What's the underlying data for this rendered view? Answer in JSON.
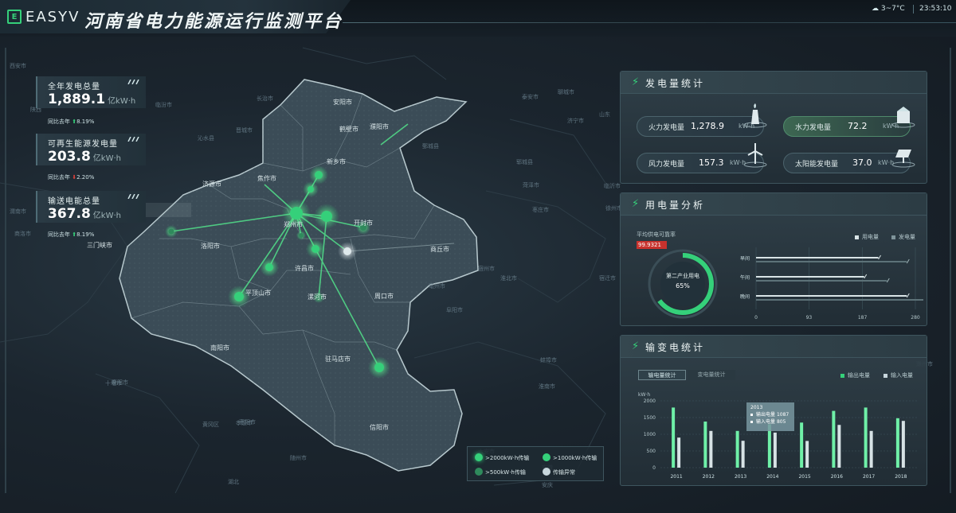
{
  "header": {
    "logo_mark": "E",
    "logo": "EASYV",
    "title": "河南省电力能源运行监测平台",
    "weather_icon": "cloud-icon",
    "temperature": "3~7°C",
    "time": "23:53:10"
  },
  "kpis": [
    {
      "label": "全年发电总量",
      "value": "1,889.1",
      "unit": "亿kW·h",
      "compare_label": "同比去年",
      "trend": "up",
      "change": "8.19%"
    },
    {
      "label": "可再生能源发电量",
      "value": "203.8",
      "unit": "亿kW·h",
      "compare_label": "同比去年",
      "trend": "down",
      "change": "2.20%"
    },
    {
      "label": "输送电能总量",
      "value": "367.8",
      "unit": "亿kW·h",
      "compare_label": "同比去年",
      "trend": "up",
      "change": "8.19%"
    }
  ],
  "map": {
    "cities": [
      "安阳市",
      "鹤壁市",
      "濮阳市",
      "新乡市",
      "焦作市",
      "济源市",
      "郑州市",
      "开封市",
      "洛阳市",
      "三门峡市",
      "许昌市",
      "平顶山市",
      "漯河市",
      "周口市",
      "商丘市",
      "南阳市",
      "驻马店市",
      "信阳市"
    ],
    "neighbors": [
      "陕西",
      "长治市",
      "运城市",
      "晋城市",
      "临汾市",
      "沁水县",
      "聊城市",
      "泰安市",
      "济宁市",
      "山东",
      "鄄城县",
      "郓城县",
      "菏泽市",
      "枣庄市",
      "临沂市",
      "徐州市",
      "宿州市",
      "淮北市",
      "亳州市",
      "阜阳市",
      "蚌埠市",
      "淮南市",
      "宿迁市",
      "六安市",
      "安庆",
      "随州市",
      "襄阳市",
      "孝感市",
      "十堰市",
      "商洛市",
      "渭南市",
      "西安市",
      "湖北",
      "安徽",
      "滁州市",
      "枣阳市",
      "黄冈区"
    ]
  },
  "map_legend": [
    {
      "label": ">2000kW·h传输",
      "color": "#35d07a"
    },
    {
      "label": ">1000kW·h传输",
      "color": "#35d07a"
    },
    {
      "label": ">500kW·h传输",
      "color": "#2f8a5c"
    },
    {
      "label": "传输异常",
      "color": "#c7d6dc"
    }
  ],
  "generation": {
    "title": "发电量统计",
    "items": [
      {
        "label": "火力发电量",
        "value": "1,278.9",
        "unit": "kW·h",
        "icon": "thermal-plant-icon"
      },
      {
        "label": "水力发电量",
        "value": "72.2",
        "unit": "kW·h",
        "icon": "hydro-dam-icon"
      },
      {
        "label": "风力发电量",
        "value": "157.3",
        "unit": "kW·h",
        "icon": "wind-turbine-icon"
      },
      {
        "label": "太阳能发电量",
        "value": "37.0",
        "unit": "kW·h",
        "icon": "solar-panel-icon"
      }
    ]
  },
  "consumption": {
    "title": "用电量分析",
    "reliability_label": "平均供电可靠率",
    "reliability_value": "99.9321",
    "gauge_label": "第二产业用电",
    "gauge_value": "65%",
    "legend": [
      "用电量",
      "发电量"
    ]
  },
  "transformer": {
    "title": "输变电统计",
    "tabs": [
      "输电量统计",
      "变电量统计"
    ],
    "legend": [
      "输出电量",
      "输入电量"
    ],
    "tooltip": {
      "year": "2013",
      "rows": [
        {
          "label": "输出电量",
          "value": "1087"
        },
        {
          "label": "输入电量",
          "value": "805"
        }
      ]
    }
  },
  "chart_data": [
    {
      "type": "bar",
      "orientation": "horizontal",
      "title": "用电量分析",
      "categories": [
        "早间",
        "午间",
        "晚间"
      ],
      "series": [
        {
          "name": "用电量",
          "values": [
            215,
            190,
            265
          ]
        },
        {
          "name": "发电量",
          "values": [
            265,
            230,
            300
          ]
        }
      ],
      "xlim": [
        0,
        280
      ],
      "xticks": [
        0,
        93,
        187,
        280
      ],
      "grid": true,
      "legend": "top-right"
    },
    {
      "type": "bar",
      "title": "输变电统计",
      "ylabel": "kW·h",
      "categories": [
        "2011",
        "2012",
        "2013",
        "2014",
        "2015",
        "2016",
        "2017",
        "2018"
      ],
      "series": [
        {
          "name": "输出电量",
          "values": [
            1800,
            1380,
            1100,
            1300,
            1350,
            1700,
            1800,
            1480
          ]
        },
        {
          "name": "输入电量",
          "values": [
            900,
            1100,
            805,
            1050,
            800,
            1280,
            1100,
            1400
          ]
        }
      ],
      "ylim": [
        0,
        2000
      ],
      "yticks": [
        0,
        500,
        1000,
        1500,
        2000
      ],
      "grid": true,
      "legend": "top-right"
    }
  ],
  "colors": {
    "accent": "#35d07a",
    "accent_dark": "#2f8a5c",
    "down": "#e0403a",
    "panel": "#2c3c44"
  }
}
